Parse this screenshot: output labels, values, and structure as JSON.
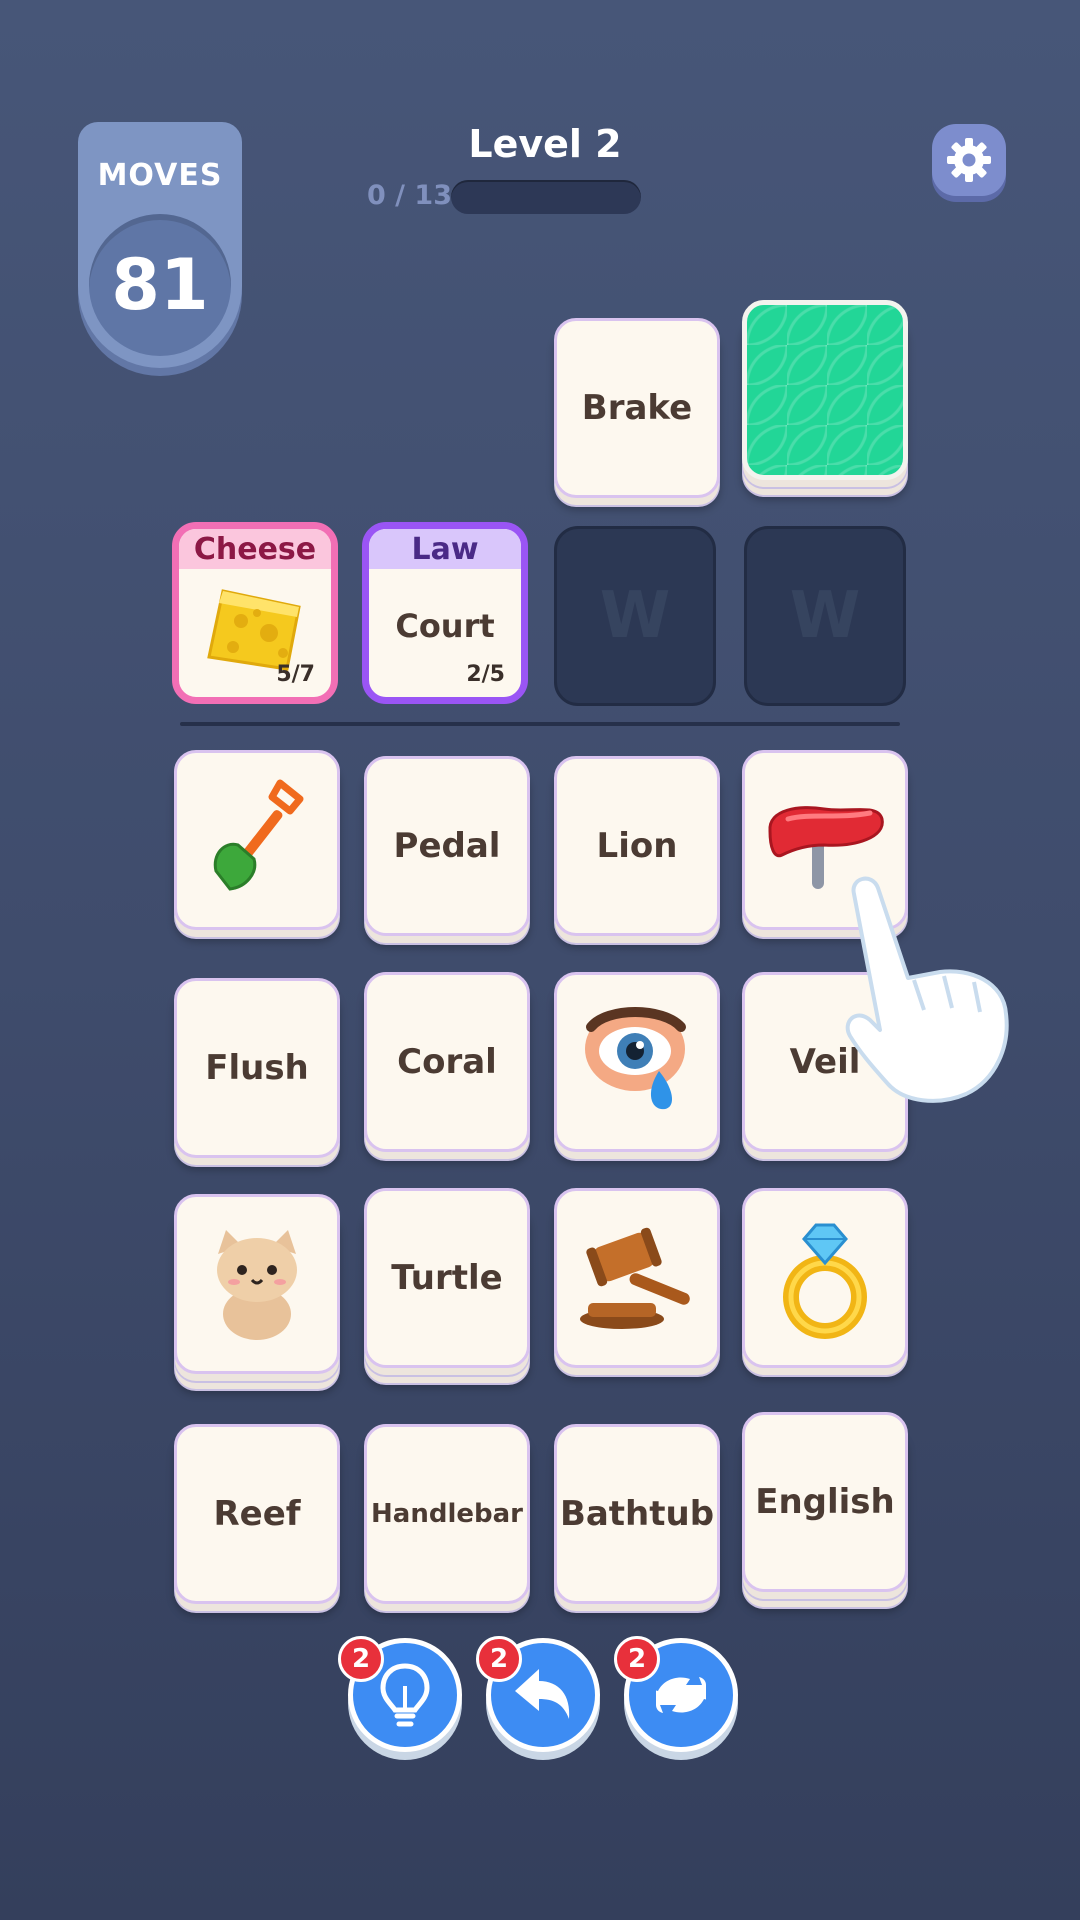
{
  "hud": {
    "moves_label": "MOVES",
    "moves_value": "81",
    "level_title": "Level 2",
    "progress_text": "0 / 13",
    "progress_fraction": 0
  },
  "icons": {
    "settings": "gear-icon",
    "deck": "card-back-pattern",
    "hint": "lightbulb-icon",
    "undo": "undo-arrow-icon",
    "shuffle": "shuffle-icon",
    "pointer": "pointing-hand-icon"
  },
  "top_cards": {
    "brake": "Brake"
  },
  "category_slots": [
    {
      "category": "Cheese",
      "progress": "5/7",
      "content_icon": "cheese-icon"
    },
    {
      "category": "Law",
      "word": "Court",
      "progress": "2/5"
    },
    {
      "empty_mark": "W"
    },
    {
      "empty_mark": "W"
    }
  ],
  "grid": {
    "row1": [
      "shovel-icon",
      "Pedal",
      "Lion",
      "bike-seat-icon"
    ],
    "row2": [
      "Flush",
      "Coral",
      "crying-eye-icon",
      "Veil"
    ],
    "row3": [
      "cat-icon",
      "Turtle",
      "gavel-icon",
      "ring-icon"
    ],
    "row4": [
      "Reef",
      "Handlebar",
      "Bathtub",
      "English"
    ],
    "labels": {
      "pedal": "Pedal",
      "lion": "Lion",
      "flush": "Flush",
      "coral": "Coral",
      "veil": "Veil",
      "turtle": "Turtle",
      "reef": "Reef",
      "handlebar": "Handlebar",
      "bathtub": "Bathtub",
      "english": "English"
    }
  },
  "powerups": {
    "hint_count": "2",
    "undo_count": "2",
    "shuffle_count": "2"
  },
  "colors": {
    "background": "#414e6f",
    "card_face": "#fdf8ef",
    "card_border": "#d9c3ef",
    "deck_green": "#22d697",
    "cheese_accent": "#f26fb5",
    "law_accent": "#9a55f5",
    "button_blue": "#3d8cf3",
    "badge_red": "#e8303b"
  }
}
